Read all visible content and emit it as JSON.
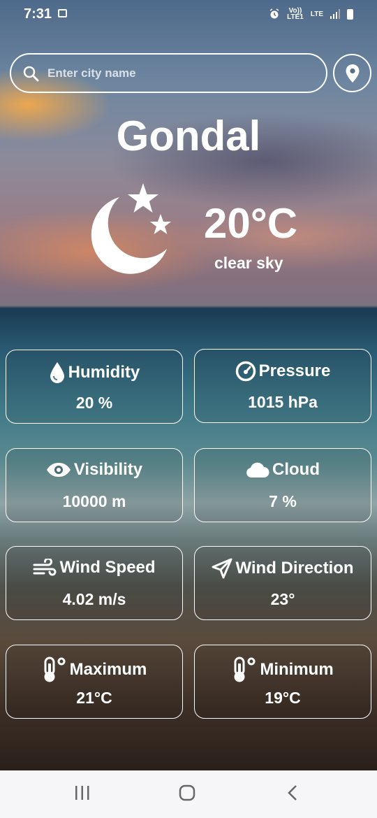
{
  "status_bar": {
    "time": "7:31",
    "network_1": "Vo))\nLTE1",
    "network_2": "LTE"
  },
  "search": {
    "placeholder": "Enter city name",
    "value": ""
  },
  "weather": {
    "city": "Gondal",
    "temperature": "20°C",
    "description": "clear sky",
    "icon": "moon-stars-icon"
  },
  "cards": [
    {
      "label": "Humidity",
      "value": "20 %",
      "icon": "drop-icon"
    },
    {
      "label": "Pressure",
      "value": "1015 hPa",
      "icon": "gauge-icon"
    },
    {
      "label": "Visibility",
      "value": "10000 m",
      "icon": "eye-icon"
    },
    {
      "label": "Cloud",
      "value": "7 %",
      "icon": "cloud-icon"
    },
    {
      "label": "Wind Speed",
      "value": "4.02 m/s",
      "icon": "wind-icon"
    },
    {
      "label": "Wind Direction",
      "value": "23°",
      "icon": "navigation-arrow-icon"
    },
    {
      "label": "Maximum",
      "value": "21°C",
      "icon": "thermometer-icon"
    },
    {
      "label": "Minimum",
      "value": "19°C",
      "icon": "thermometer-icon"
    }
  ],
  "nav": [
    "recent-apps",
    "home",
    "back"
  ]
}
